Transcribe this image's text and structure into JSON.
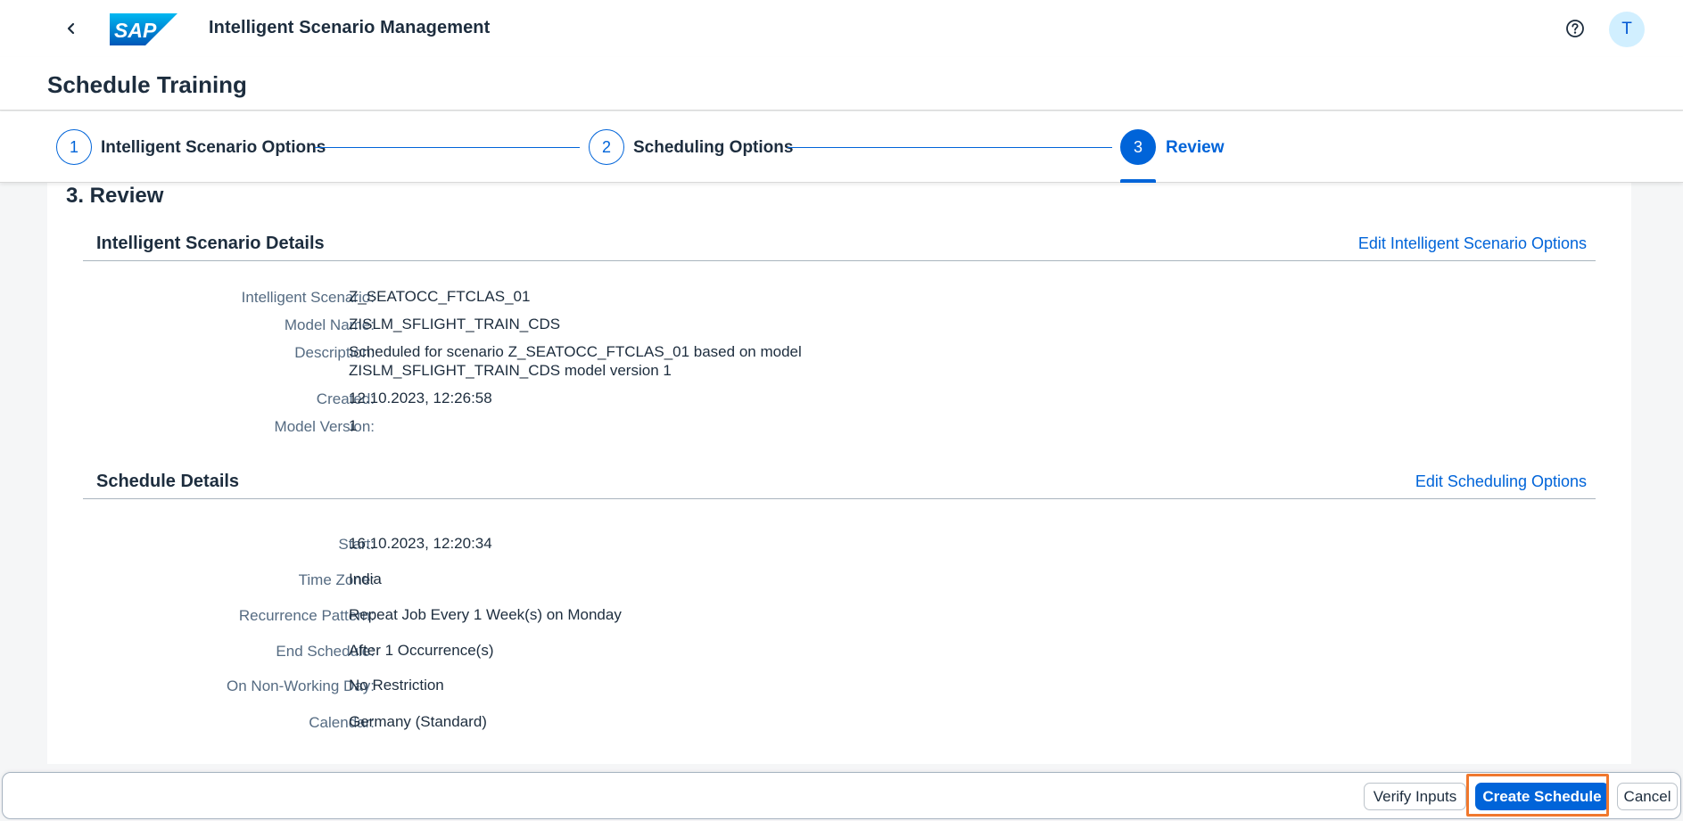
{
  "shell": {
    "app_title": "Intelligent Scenario Management",
    "logo_text": "SAP",
    "avatar_initial": "T",
    "icons": {
      "back": "chevron-left-icon",
      "help": "question-circle-icon"
    }
  },
  "page": {
    "title": "Schedule Training"
  },
  "wizard": {
    "steps": [
      {
        "number": "1",
        "label": "Intelligent Scenario Options",
        "state": "completed"
      },
      {
        "number": "2",
        "label": "Scheduling Options",
        "state": "completed"
      },
      {
        "number": "3",
        "label": "Review",
        "state": "active"
      }
    ]
  },
  "review": {
    "heading": "3. Review",
    "scenario_details": {
      "title": "Intelligent Scenario Details",
      "edit_link": "Edit Intelligent Scenario Options",
      "fields": [
        {
          "label": "Intelligent Scenario:",
          "value": "Z_SEATOCC_FTCLAS_01"
        },
        {
          "label": "Model Name:",
          "value": "ZISLM_SFLIGHT_TRAIN_CDS"
        },
        {
          "label": "Description:",
          "value": "Scheduled for scenario Z_SEATOCC_FTCLAS_01 based on model",
          "value_line2": "ZISLM_SFLIGHT_TRAIN_CDS model version 1"
        },
        {
          "label": "Created:",
          "value": "12.10.2023, 12:26:58"
        },
        {
          "label": "Model Version:",
          "value": "1"
        }
      ]
    },
    "schedule_details": {
      "title": "Schedule Details",
      "edit_link": "Edit Scheduling Options",
      "fields": [
        {
          "label": "Start:",
          "value": "16.10.2023, 12:20:34"
        },
        {
          "label": "Time Zone:",
          "value": "India"
        },
        {
          "label": "Recurrence Pattern:",
          "value": "Repeat Job Every 1 Week(s) on Monday"
        },
        {
          "label": "End Schedule:",
          "value": "After 1 Occurrence(s)"
        },
        {
          "label": "On Non-Working Day:",
          "value": "No Restriction"
        },
        {
          "label": "Calendar:",
          "value": "Germany (Standard)"
        }
      ]
    }
  },
  "footer": {
    "verify_label": "Verify Inputs",
    "create_label": "Create Schedule",
    "cancel_label": "Cancel"
  },
  "colors": {
    "accent": "#0064d9",
    "highlight": "#f0782d",
    "avatar_bg": "#d1efff"
  }
}
